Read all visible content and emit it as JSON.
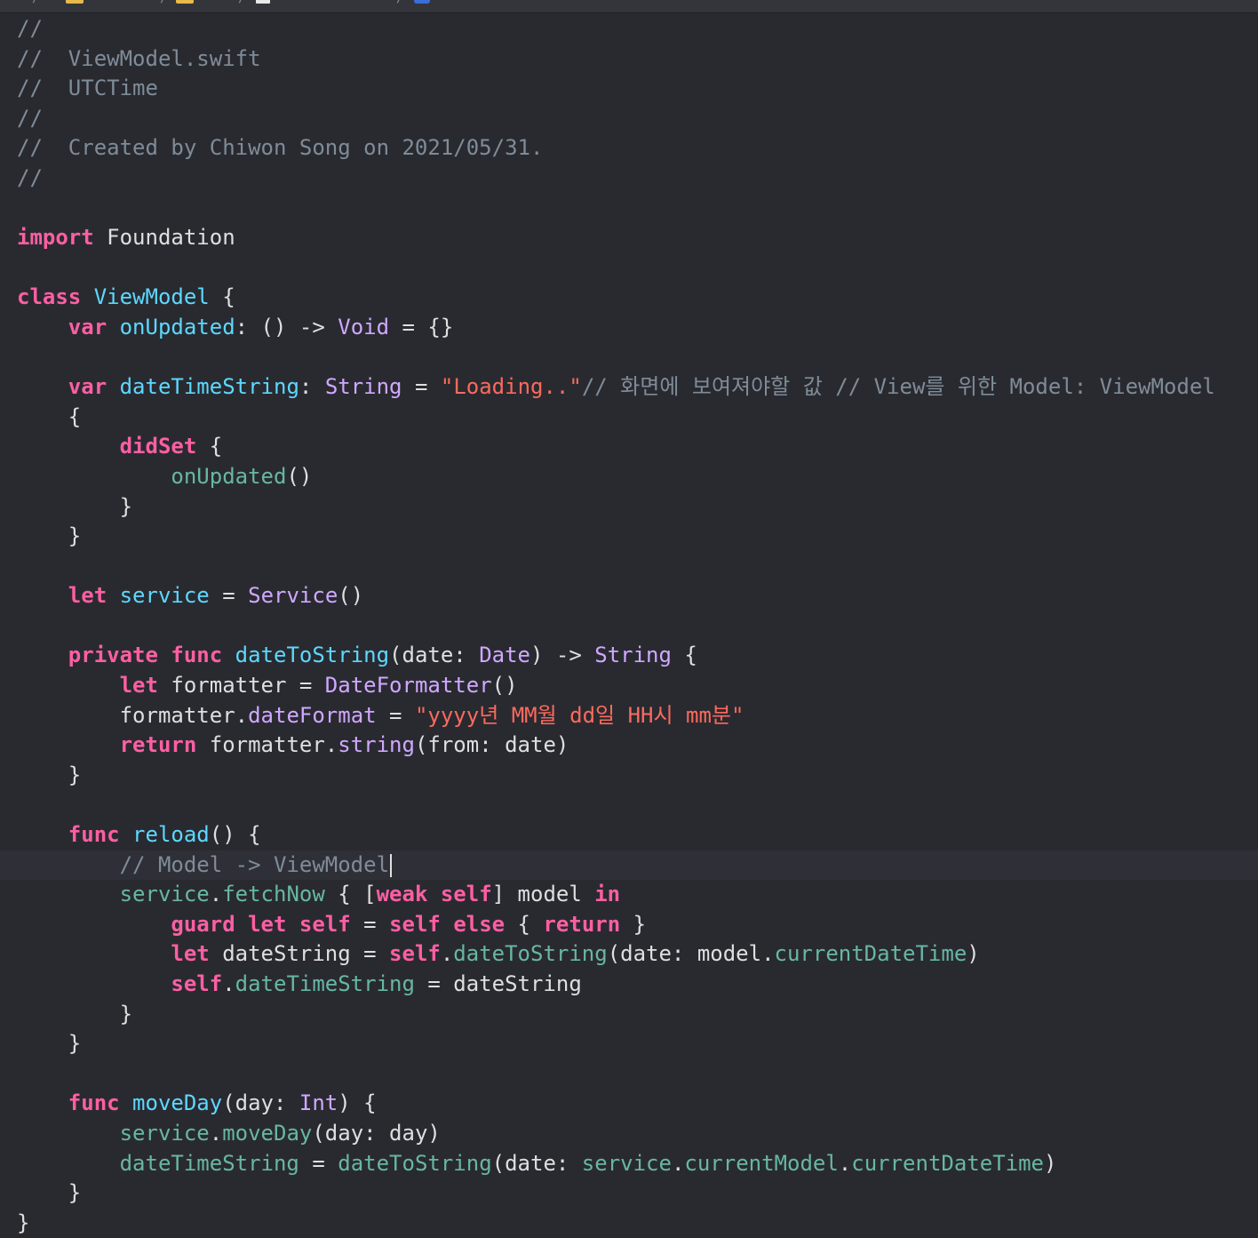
{
  "colors": {
    "background": "#292a30",
    "keyword": "#fc5fa3",
    "type": "#d0a8ff",
    "declaration": "#5dd8ff",
    "call": "#67b7a4",
    "string": "#fc6a5d",
    "comment": "#7f8c98",
    "plain": "#dfdfe0"
  },
  "breadcrumb_icons": [
    "folder-icon",
    "folder-icon",
    "file-icon",
    "swift-file-icon"
  ],
  "code": {
    "lines": [
      [
        {
          "c": "comment",
          "t": "//"
        }
      ],
      [
        {
          "c": "comment",
          "t": "//  ViewModel.swift"
        }
      ],
      [
        {
          "c": "comment",
          "t": "//  UTCTime"
        }
      ],
      [
        {
          "c": "comment",
          "t": "//"
        }
      ],
      [
        {
          "c": "comment",
          "t": "//  Created by Chiwon Song on 2021/05/31."
        }
      ],
      [
        {
          "c": "comment",
          "t": "//"
        }
      ],
      [],
      [
        {
          "c": "kw",
          "t": "import"
        },
        {
          "c": "plain",
          "t": " Foundation"
        }
      ],
      [],
      [
        {
          "c": "kw",
          "t": "class"
        },
        {
          "c": "plain",
          "t": " "
        },
        {
          "c": "decl",
          "t": "ViewModel"
        },
        {
          "c": "plain",
          "t": " {"
        }
      ],
      [
        {
          "c": "plain",
          "t": "    "
        },
        {
          "c": "kw",
          "t": "var"
        },
        {
          "c": "plain",
          "t": " "
        },
        {
          "c": "decl",
          "t": "onUpdated"
        },
        {
          "c": "plain",
          "t": ": () -> "
        },
        {
          "c": "type",
          "t": "Void"
        },
        {
          "c": "plain",
          "t": " = {}"
        }
      ],
      [],
      [
        {
          "c": "plain",
          "t": "    "
        },
        {
          "c": "kw",
          "t": "var"
        },
        {
          "c": "plain",
          "t": " "
        },
        {
          "c": "decl",
          "t": "dateTimeString"
        },
        {
          "c": "plain",
          "t": ": "
        },
        {
          "c": "type",
          "t": "String"
        },
        {
          "c": "plain",
          "t": " = "
        },
        {
          "c": "str",
          "t": "\"Loading..\""
        },
        {
          "c": "comment",
          "t": "// 화면에 보여져야할 값 // View를 위한 Model: ViewModel"
        }
      ],
      [
        {
          "c": "plain",
          "t": "    {"
        }
      ],
      [
        {
          "c": "plain",
          "t": "        "
        },
        {
          "c": "kw",
          "t": "didSet"
        },
        {
          "c": "plain",
          "t": " {"
        }
      ],
      [
        {
          "c": "plain",
          "t": "            "
        },
        {
          "c": "call",
          "t": "onUpdated"
        },
        {
          "c": "plain",
          "t": "()"
        }
      ],
      [
        {
          "c": "plain",
          "t": "        }"
        }
      ],
      [
        {
          "c": "plain",
          "t": "    }"
        }
      ],
      [],
      [
        {
          "c": "plain",
          "t": "    "
        },
        {
          "c": "kw",
          "t": "let"
        },
        {
          "c": "plain",
          "t": " "
        },
        {
          "c": "decl",
          "t": "service"
        },
        {
          "c": "plain",
          "t": " = "
        },
        {
          "c": "type",
          "t": "Service"
        },
        {
          "c": "plain",
          "t": "()"
        }
      ],
      [],
      [
        {
          "c": "plain",
          "t": "    "
        },
        {
          "c": "kw",
          "t": "private"
        },
        {
          "c": "plain",
          "t": " "
        },
        {
          "c": "kw",
          "t": "func"
        },
        {
          "c": "plain",
          "t": " "
        },
        {
          "c": "decl",
          "t": "dateToString"
        },
        {
          "c": "plain",
          "t": "(date: "
        },
        {
          "c": "type",
          "t": "Date"
        },
        {
          "c": "plain",
          "t": ") -> "
        },
        {
          "c": "type",
          "t": "String"
        },
        {
          "c": "plain",
          "t": " {"
        }
      ],
      [
        {
          "c": "plain",
          "t": "        "
        },
        {
          "c": "kw",
          "t": "let"
        },
        {
          "c": "plain",
          "t": " formatter = "
        },
        {
          "c": "type",
          "t": "DateFormatter"
        },
        {
          "c": "plain",
          "t": "()"
        }
      ],
      [
        {
          "c": "plain",
          "t": "        formatter."
        },
        {
          "c": "type",
          "t": "dateFormat"
        },
        {
          "c": "plain",
          "t": " = "
        },
        {
          "c": "str",
          "t": "\"yyyy년 MM월 dd일 HH시 mm분\""
        }
      ],
      [
        {
          "c": "plain",
          "t": "        "
        },
        {
          "c": "kw",
          "t": "return"
        },
        {
          "c": "plain",
          "t": " formatter."
        },
        {
          "c": "type",
          "t": "string"
        },
        {
          "c": "plain",
          "t": "(from: date)"
        }
      ],
      [
        {
          "c": "plain",
          "t": "    }"
        }
      ],
      [],
      [
        {
          "c": "plain",
          "t": "    "
        },
        {
          "c": "kw",
          "t": "func"
        },
        {
          "c": "plain",
          "t": " "
        },
        {
          "c": "decl",
          "t": "reload"
        },
        {
          "c": "plain",
          "t": "() {"
        }
      ],
      [
        {
          "c": "plain",
          "t": "        "
        },
        {
          "c": "comment",
          "t": "// Model -> ViewModel"
        }
      ],
      [
        {
          "c": "plain",
          "t": "        "
        },
        {
          "c": "call",
          "t": "service"
        },
        {
          "c": "plain",
          "t": "."
        },
        {
          "c": "call",
          "t": "fetchNow"
        },
        {
          "c": "plain",
          "t": " { ["
        },
        {
          "c": "kw",
          "t": "weak"
        },
        {
          "c": "plain",
          "t": " "
        },
        {
          "c": "kw",
          "t": "self"
        },
        {
          "c": "plain",
          "t": "] model "
        },
        {
          "c": "kw",
          "t": "in"
        }
      ],
      [
        {
          "c": "plain",
          "t": "            "
        },
        {
          "c": "kw",
          "t": "guard"
        },
        {
          "c": "plain",
          "t": " "
        },
        {
          "c": "kw",
          "t": "let"
        },
        {
          "c": "plain",
          "t": " "
        },
        {
          "c": "kw",
          "t": "self"
        },
        {
          "c": "plain",
          "t": " = "
        },
        {
          "c": "kw",
          "t": "self"
        },
        {
          "c": "plain",
          "t": " "
        },
        {
          "c": "kw",
          "t": "else"
        },
        {
          "c": "plain",
          "t": " { "
        },
        {
          "c": "kw",
          "t": "return"
        },
        {
          "c": "plain",
          "t": " }"
        }
      ],
      [
        {
          "c": "plain",
          "t": "            "
        },
        {
          "c": "kw",
          "t": "let"
        },
        {
          "c": "plain",
          "t": " dateString = "
        },
        {
          "c": "kw",
          "t": "self"
        },
        {
          "c": "plain",
          "t": "."
        },
        {
          "c": "call",
          "t": "dateToString"
        },
        {
          "c": "plain",
          "t": "(date: model."
        },
        {
          "c": "call",
          "t": "currentDateTime"
        },
        {
          "c": "plain",
          "t": ")"
        }
      ],
      [
        {
          "c": "plain",
          "t": "            "
        },
        {
          "c": "kw",
          "t": "self"
        },
        {
          "c": "plain",
          "t": "."
        },
        {
          "c": "call",
          "t": "dateTimeString"
        },
        {
          "c": "plain",
          "t": " = dateString"
        }
      ],
      [
        {
          "c": "plain",
          "t": "        }"
        }
      ],
      [
        {
          "c": "plain",
          "t": "    }"
        }
      ],
      [],
      [
        {
          "c": "plain",
          "t": "    "
        },
        {
          "c": "kw",
          "t": "func"
        },
        {
          "c": "plain",
          "t": " "
        },
        {
          "c": "decl",
          "t": "moveDay"
        },
        {
          "c": "plain",
          "t": "(day: "
        },
        {
          "c": "type",
          "t": "Int"
        },
        {
          "c": "plain",
          "t": ") {"
        }
      ],
      [
        {
          "c": "plain",
          "t": "        "
        },
        {
          "c": "call",
          "t": "service"
        },
        {
          "c": "plain",
          "t": "."
        },
        {
          "c": "call",
          "t": "moveDay"
        },
        {
          "c": "plain",
          "t": "(day: day)"
        }
      ],
      [
        {
          "c": "plain",
          "t": "        "
        },
        {
          "c": "call",
          "t": "dateTimeString"
        },
        {
          "c": "plain",
          "t": " = "
        },
        {
          "c": "call",
          "t": "dateToString"
        },
        {
          "c": "plain",
          "t": "(date: "
        },
        {
          "c": "call",
          "t": "service"
        },
        {
          "c": "plain",
          "t": "."
        },
        {
          "c": "call",
          "t": "currentModel"
        },
        {
          "c": "plain",
          "t": "."
        },
        {
          "c": "call",
          "t": "currentDateTime"
        },
        {
          "c": "plain",
          "t": ")"
        }
      ],
      [
        {
          "c": "plain",
          "t": "    }"
        }
      ],
      [
        {
          "c": "plain",
          "t": "}"
        }
      ]
    ],
    "current_line_index": 28
  }
}
